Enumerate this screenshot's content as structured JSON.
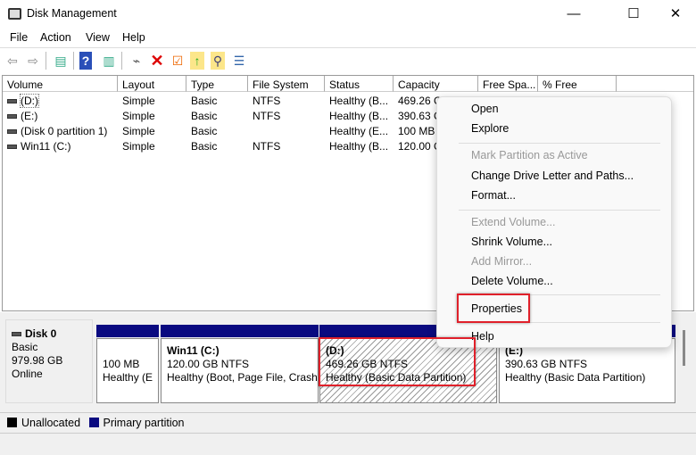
{
  "window": {
    "title": "Disk Management",
    "minimize": "—",
    "maximize": "☐",
    "close": "✕"
  },
  "menu": [
    "File",
    "Action",
    "View",
    "Help"
  ],
  "toolbar": [
    "back-icon",
    "forward-icon",
    "console-tree-icon",
    "help-icon",
    "action-pane-icon",
    "connect-drive-icon",
    "delete-icon",
    "properties-icon",
    "folder-up-icon",
    "folder-search-icon",
    "checklist-icon"
  ],
  "table": {
    "columns": [
      "Volume",
      "Layout",
      "Type",
      "File System",
      "Status",
      "Capacity",
      "Free Spa...",
      "% Free"
    ],
    "rows": [
      [
        "(D:)",
        "Simple",
        "Basic",
        "NTFS",
        "Healthy (B...",
        "469.26 GB"
      ],
      [
        "(E:)",
        "Simple",
        "Basic",
        "NTFS",
        "Healthy (B...",
        "390.63 GB"
      ],
      [
        "(Disk 0 partition 1)",
        "Simple",
        "Basic",
        "",
        "Healthy (E...",
        "100 MB"
      ],
      [
        "Win11 (C:)",
        "Simple",
        "Basic",
        "NTFS",
        "Healthy (B...",
        "120.00 GB"
      ]
    ]
  },
  "disk": {
    "name": "Disk 0",
    "type": "Basic",
    "size": "979.98 GB",
    "status": "Online",
    "partitions": [
      {
        "title": "",
        "size": "100 MB",
        "status": "Healthy (E"
      },
      {
        "title": "Win11  (C:)",
        "size": "120.00 GB NTFS",
        "status": "Healthy (Boot, Page File, Crash"
      },
      {
        "title": "(D:)",
        "size": "469.26 GB NTFS",
        "status": "Healthy (Basic Data Partition)"
      },
      {
        "title": "(E:)",
        "size": "390.63 GB NTFS",
        "status": "Healthy (Basic Data Partition)"
      }
    ]
  },
  "legend": {
    "unallocated": "Unallocated",
    "primary": "Primary partition",
    "colors": {
      "unallocated": "#000000",
      "primary": "#0a0a80"
    }
  },
  "context_menu": {
    "items": [
      "Open",
      "Explore",
      "Mark Partition as Active",
      "Change Drive Letter and Paths...",
      "Format...",
      "Extend Volume...",
      "Shrink Volume...",
      "Add Mirror...",
      "Delete Volume...",
      "Properties",
      "Help"
    ],
    "disabled": [
      "Mark Partition as Active",
      "Extend Volume...",
      "Add Mirror..."
    ]
  }
}
